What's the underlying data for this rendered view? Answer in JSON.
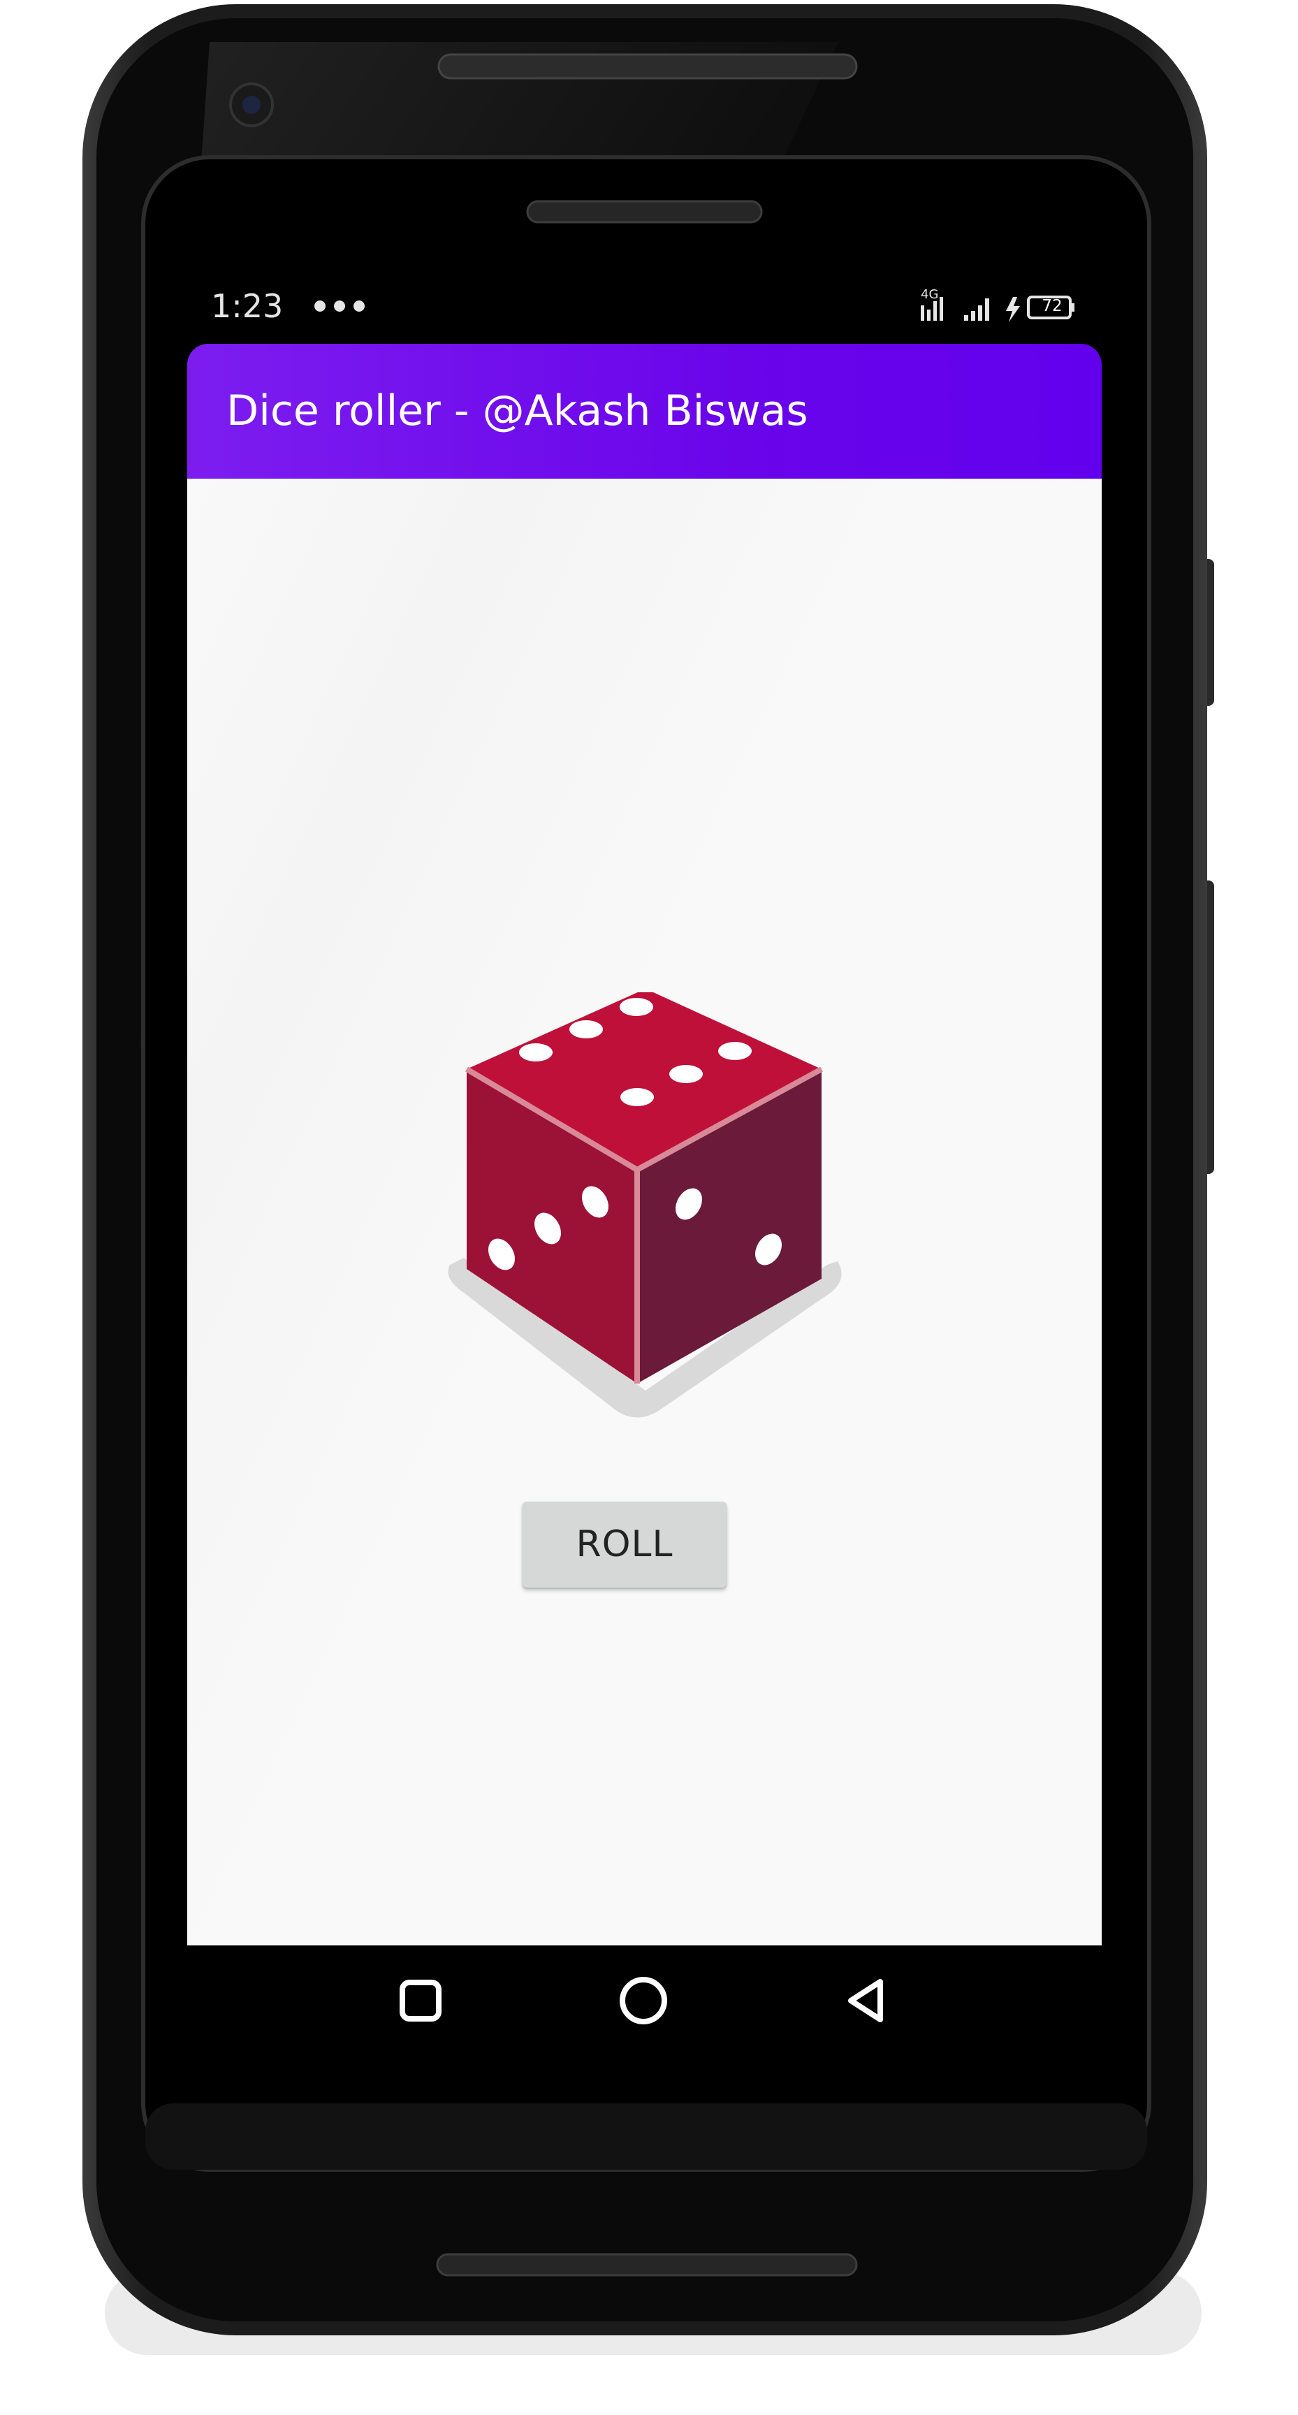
{
  "status_bar": {
    "time": "1:23",
    "network": "4G",
    "battery": "72",
    "icons": [
      "notification-dots-icon",
      "signal-4g-icon",
      "signal-icon",
      "charging-icon",
      "battery-icon"
    ]
  },
  "app_bar": {
    "title": "Dice roller - @Akash Biswas",
    "color": "#6200ee"
  },
  "main": {
    "dice": {
      "top_face_pips": 6,
      "left_face_pips": 3,
      "right_face_pips": 2,
      "color": "#be1038"
    },
    "roll_button_label": "ROLL"
  },
  "nav_bar": {
    "items": [
      "overview-square-icon",
      "home-circle-icon",
      "back-triangle-icon"
    ]
  }
}
